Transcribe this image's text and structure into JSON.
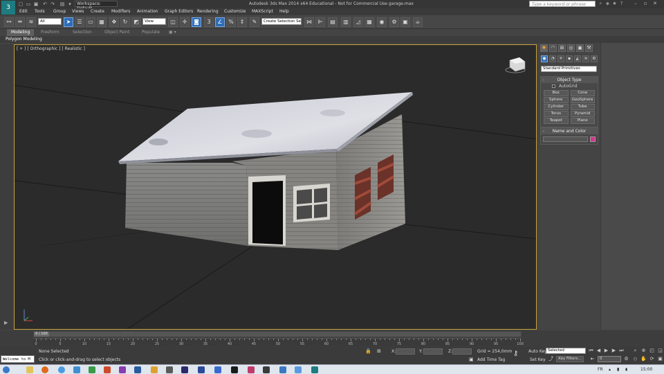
{
  "title_bar": {
    "app_logo": "3",
    "workspace": "Workspace: Default",
    "title": "Autodesk 3ds Max  2014 x64    Educational - Not for Commercial Use    garage.max",
    "search_placeholder": "Type a keyword or phrase"
  },
  "menu": [
    "Edit",
    "Tools",
    "Group",
    "Views",
    "Create",
    "Modifiers",
    "Animation",
    "Graph Editors",
    "Rendering",
    "Customize",
    "MAXScript",
    "Help"
  ],
  "toolbar": {
    "selection_filter": "All",
    "reference_coord": "View",
    "named_selection": "Create Selection Se",
    "snap_number": "3"
  },
  "ribbon": {
    "tabs": [
      "Modeling",
      "Freeform",
      "Selection",
      "Object Paint",
      "Populate"
    ],
    "active_tab": "Modeling",
    "panel_label": "Polygon Modeling"
  },
  "viewport": {
    "label": "[ + ] [ Orthographic ] [ Realistic ]",
    "background": "#2b2b2b",
    "border_color": "#c8a23a"
  },
  "command_panel": {
    "category": "Standard Primitives",
    "object_type": {
      "title": "Object Type",
      "autogrid": "AutoGrid",
      "buttons": [
        "Box",
        "Cone",
        "Sphere",
        "GeoSphere",
        "Cylinder",
        "Tube",
        "Torus",
        "Pyramid",
        "Teapot",
        "Plane"
      ]
    },
    "name_and_color": {
      "title": "Name and Color",
      "color": "#d6338a"
    }
  },
  "timeline": {
    "frame_display": "0 / 100",
    "ticks": [
      "0",
      "5",
      "10",
      "15",
      "20",
      "25",
      "30",
      "35",
      "40",
      "45",
      "50",
      "55",
      "60",
      "65",
      "70",
      "75",
      "80",
      "85",
      "90",
      "95",
      "100"
    ]
  },
  "status": {
    "maxscript": "Welcome to M",
    "selection": "None Selected",
    "prompt": "Click or click-and-drag to select objects",
    "x_label": "X:",
    "y_label": "Y:",
    "z_label": "Z:",
    "grid": "Grid = 254,0mm",
    "add_time_tag": "Add Time Tag",
    "auto_key": "Auto Key",
    "set_key": "Set Key",
    "key_mode": "Selected",
    "key_filters": "Key Filters...",
    "frame": "0"
  },
  "taskbar": {
    "lang": "FR",
    "time": "15:00"
  }
}
